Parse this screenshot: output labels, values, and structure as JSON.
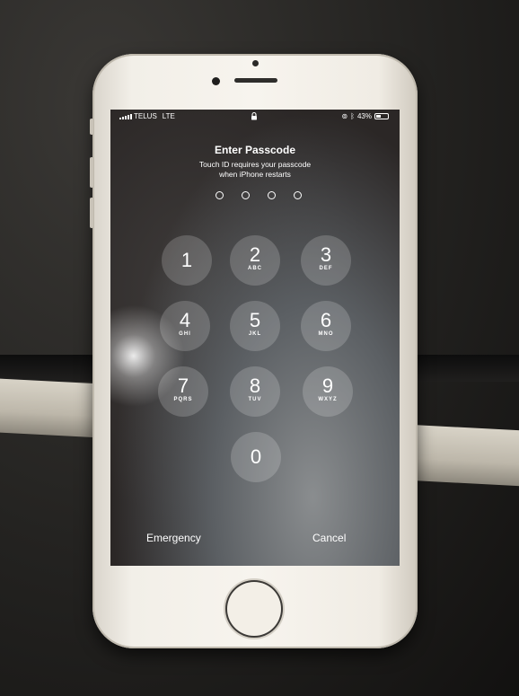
{
  "status_bar": {
    "carrier": "TELUS",
    "network": "LTE",
    "battery_text": "43%",
    "battery_level": 0.43,
    "icons": [
      "signal-icon",
      "lock-icon",
      "rotation-lock-icon",
      "bluetooth-icon",
      "battery-icon"
    ]
  },
  "lock_screen": {
    "title": "Enter Passcode",
    "subtitle_line1": "Touch ID requires your passcode",
    "subtitle_line2": "when iPhone restarts",
    "passcode_length": 4,
    "keys": [
      {
        "digit": "1",
        "letters": ""
      },
      {
        "digit": "2",
        "letters": "ABC"
      },
      {
        "digit": "3",
        "letters": "DEF"
      },
      {
        "digit": "4",
        "letters": "GHI"
      },
      {
        "digit": "5",
        "letters": "JKL"
      },
      {
        "digit": "6",
        "letters": "MNO"
      },
      {
        "digit": "7",
        "letters": "PQRS"
      },
      {
        "digit": "8",
        "letters": "TUV"
      },
      {
        "digit": "9",
        "letters": "WXYZ"
      },
      {
        "digit": "0",
        "letters": ""
      }
    ],
    "emergency_label": "Emergency",
    "cancel_label": "Cancel"
  }
}
